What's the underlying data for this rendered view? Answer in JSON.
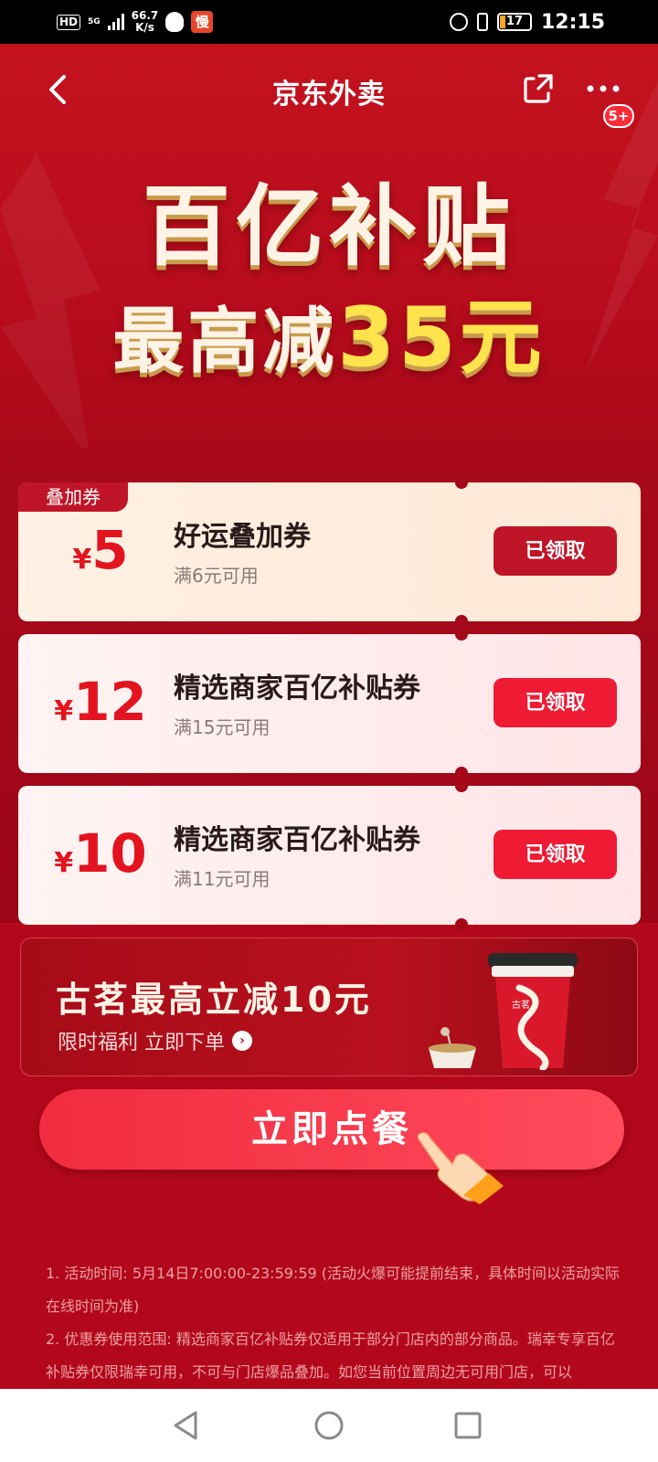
{
  "status_bar": {
    "hd": "HD",
    "net": "5G",
    "speed_value": "66.7",
    "speed_unit": "K/s",
    "app_icon_text": "慢",
    "battery": "17",
    "time": "12:15"
  },
  "nav": {
    "title": "京东外卖",
    "badge": "5+"
  },
  "hero": {
    "headline_1": "百亿补贴",
    "headline_2_prefix": "最高减",
    "headline_2_amount": "35元"
  },
  "coupons": [
    {
      "tag": "叠加券",
      "currency": "¥",
      "amount": "5",
      "name": "好运叠加券",
      "condition": "满6元可用",
      "button": "已领取"
    },
    {
      "currency": "¥",
      "amount": "12",
      "name": "精选商家百亿补贴券",
      "condition": "满15元可用",
      "button": "已领取"
    },
    {
      "currency": "¥",
      "amount": "10",
      "name": "精选商家百亿补贴券",
      "condition": "满11元可用",
      "button": "已领取"
    }
  ],
  "promo": {
    "title": "古茗最高立减10元",
    "subtitle": "限时福利 立即下单",
    "cup_text": "古茗"
  },
  "cta": {
    "label": "立即点餐"
  },
  "rules": {
    "line1": "1. 活动时间: 5月14日7:00:00-23:59:59 (活动火爆可能提前结束，具体时间以活动实际在线时间为准)",
    "line2": "2. 优惠券使用范围: 精选商家百亿补贴券仅适用于部分门店内的部分商品。瑞幸专享百亿补贴券仅限瑞幸可用，不可与门店爆品叠加。如您当前位置周边无可用门店，可以"
  },
  "colors": {
    "primary_red": "#b3081b",
    "button_red": "#ef1a34",
    "gold": "#ffe34d"
  }
}
